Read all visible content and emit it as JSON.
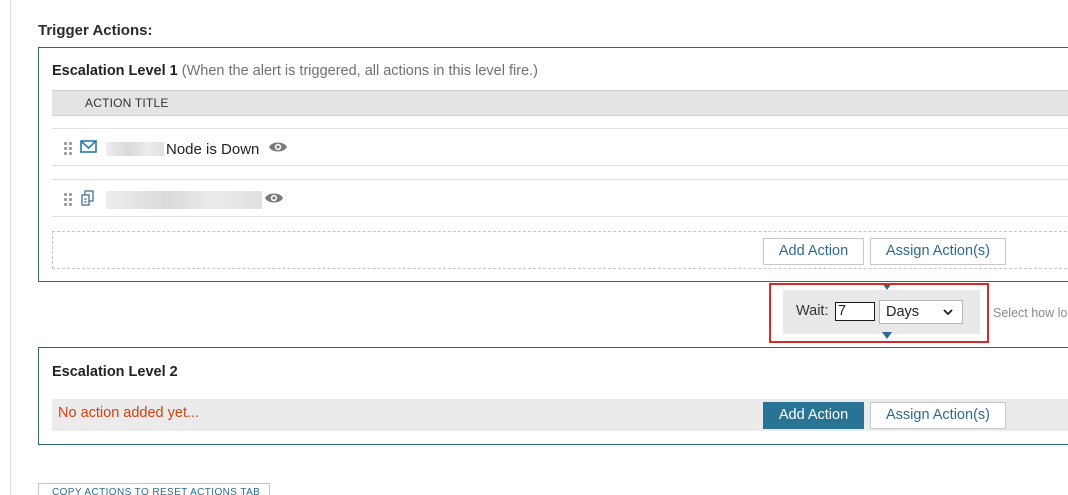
{
  "section": {
    "title": "Trigger Actions:"
  },
  "level1": {
    "title": "Escalation Level 1",
    "hint": "(When the alert is triggered, all actions in this level fire.)",
    "column_header": "ACTION TITLE",
    "actions": [
      {
        "icon": "envelope-icon",
        "text": "Node is Down"
      },
      {
        "icon": "document-icon",
        "text": ""
      }
    ],
    "add_action_label": "Add Action",
    "assign_actions_label": "Assign Action(s)"
  },
  "wait": {
    "label": "Wait:",
    "value": "7",
    "unit": "Days",
    "side_hint": "Select how lo"
  },
  "level2": {
    "title": "Escalation Level 2",
    "empty_text": "No action added yet...",
    "add_action_label": "Add Action",
    "assign_actions_label": "Assign Action(s)"
  },
  "footer": {
    "copy_button_label": "COPY ACTIONS TO RESET ACTIONS TAB"
  },
  "colors": {
    "panel_border": "#33627b",
    "primary_button": "#297394",
    "link_text": "#2e6a8e",
    "empty_text": "#d4410f",
    "highlight_border": "#d62a2a"
  }
}
